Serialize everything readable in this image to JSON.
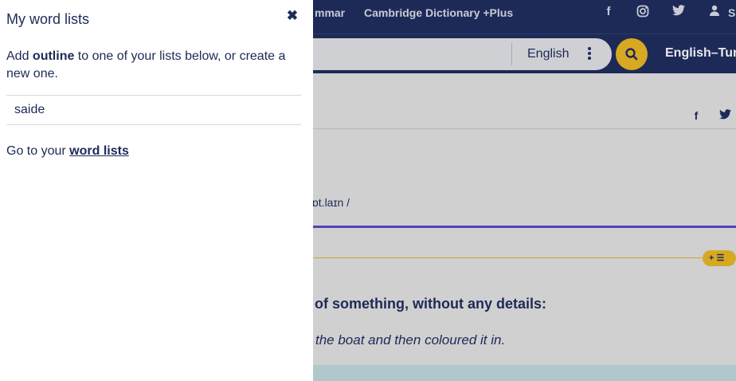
{
  "header": {
    "nav_links": [
      "mmar",
      "Cambridge Dictionary +Plus"
    ],
    "social_icons": [
      "facebook-icon",
      "instagram-icon",
      "twitter-icon"
    ],
    "user_label": "S"
  },
  "search": {
    "language": "English",
    "dictionary_label": "English–Tur"
  },
  "entry": {
    "pronunciation": "ɒt.laɪn /",
    "definition": "e of something, without any details:",
    "example": "the boat and then coloured it in."
  },
  "word_list_panel": {
    "title": "My word lists",
    "intro_prefix": "Add ",
    "intro_word": "outline",
    "intro_suffix": " to one of your lists below, or create a new one.",
    "lists": [
      "saide"
    ],
    "goto_prefix": "Go to your ",
    "goto_link": "word lists"
  },
  "colors": {
    "brand_navy": "#1d2a57",
    "accent_gold": "#d7a822",
    "accent_purple": "#5a3fb5"
  }
}
